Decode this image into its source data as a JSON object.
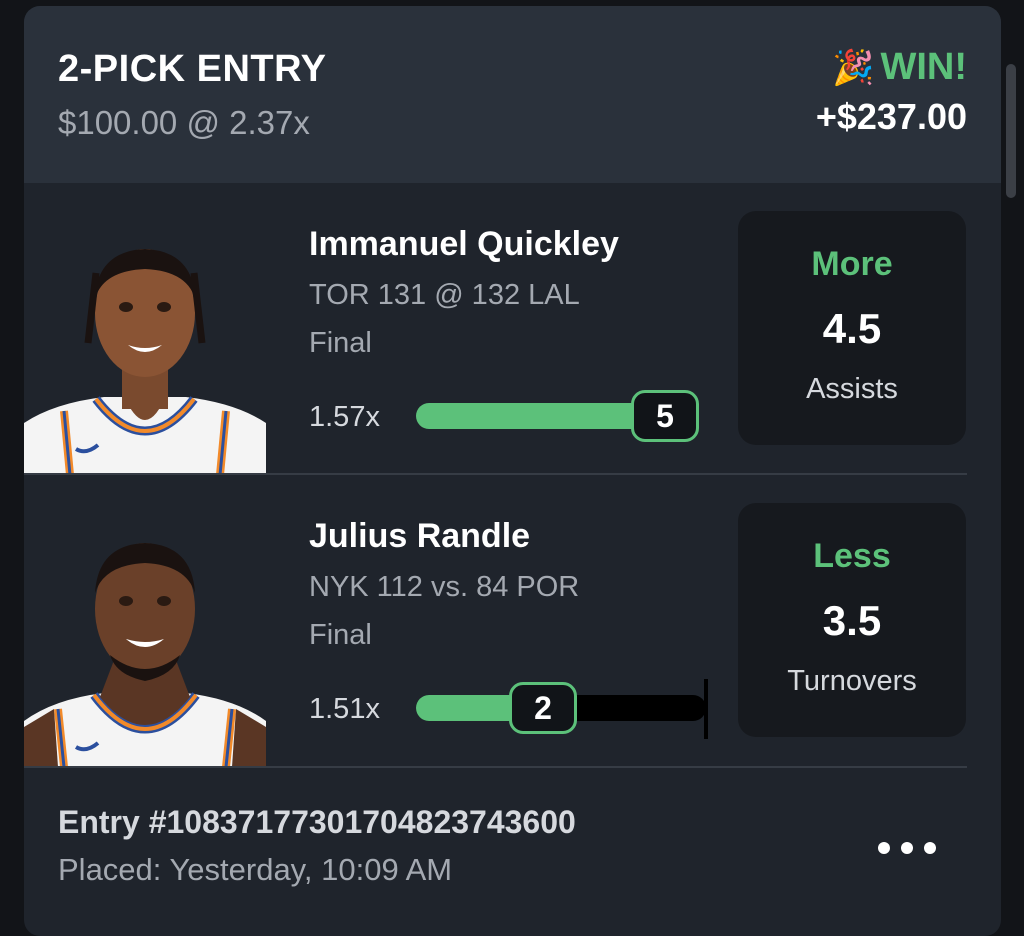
{
  "entry": {
    "title": "2-PICK ENTRY",
    "subtitle": "$100.00 @ 2.37x",
    "result_emoji": "🎉",
    "result": "WIN!",
    "payout": "+$237.00"
  },
  "picks": [
    {
      "player": "Immanuel Quickley",
      "game": "TOR 131 @ 132 LAL",
      "status": "Final",
      "multiplier": "1.57x",
      "actual": "5",
      "direction": "More",
      "line": "4.5",
      "stat": "Assists",
      "progress": 1.0
    },
    {
      "player": "Julius Randle",
      "game": "NYK 112 vs. 84 POR",
      "status": "Final",
      "multiplier": "1.51x",
      "actual": "2",
      "direction": "Less",
      "line": "3.5",
      "stat": "Turnovers",
      "progress": 0.57
    }
  ],
  "footer": {
    "entry_id": "Entry #1083717730170482374360​0",
    "placed": "Placed: Yesterday, 10:09 AM"
  },
  "colors": {
    "accent": "#5cc17a",
    "card": "#1f242c",
    "header": "#2a313b",
    "line_box": "#16191e"
  }
}
